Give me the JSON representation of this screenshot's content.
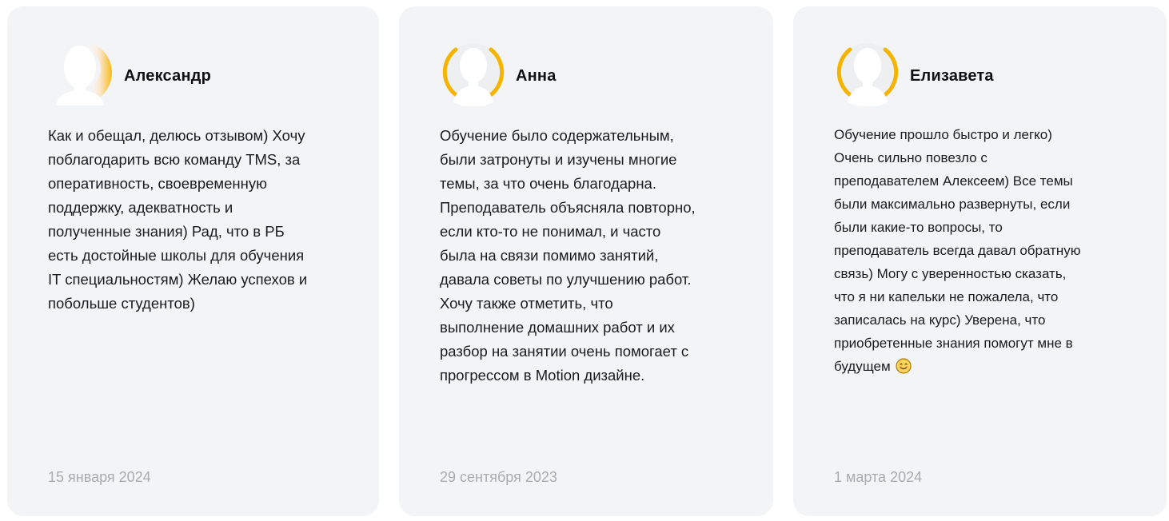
{
  "reviews": [
    {
      "author": "Александр",
      "text": "Как и обещал, делюсь отзывом) Хочу\nпоблагодарить всю команду TMS, за\nоперативность, своевременную\nподдержку, адекватность и\nполученные знания) Рад, что в РБ\nесть достойные школы для обучения\nIT специальностям) Желаю успехов и\nпобольше студентов)",
      "date": "15 января 2024"
    },
    {
      "author": "Анна",
      "text": "Обучение было содержательным,\nбыли затронуты и изучены многие\nтемы, за что очень благодарна.\nПреподаватель объясняла повторно,\nесли кто-то не понимал, и часто\nбыла на связи помимо занятий,\nдавала советы по улучшению работ.\nХочу также отметить, что\nвыполнение домашних работ и их\nразбор на занятии очень помогает с\nпрогрессом в Motion дизайне.",
      "date": "29 сентября 2023"
    },
    {
      "author": "Елизавета",
      "text": "Обучение прошло быстро и легко)\nОчень сильно повезло с\nпреподавателем Алексеем) Все темы\nбыли максимально развернуты, если\nбыли какие-то вопросы, то\nпреподаватель всегда давал обратную\nсвязь) Могу с уверенностью сказать,\nчто я ни капельки не пожалела, что\nзаписалась на курс) Уверена, что\nприобретенные знания помогут мне в\nбудущем",
      "emoji_icon": "smiling-face-icon",
      "date": "1 марта 2024"
    }
  ],
  "colors": {
    "card_background": "#f3f4f6",
    "accent": "#f5b400",
    "date_text": "#a8abb1"
  }
}
